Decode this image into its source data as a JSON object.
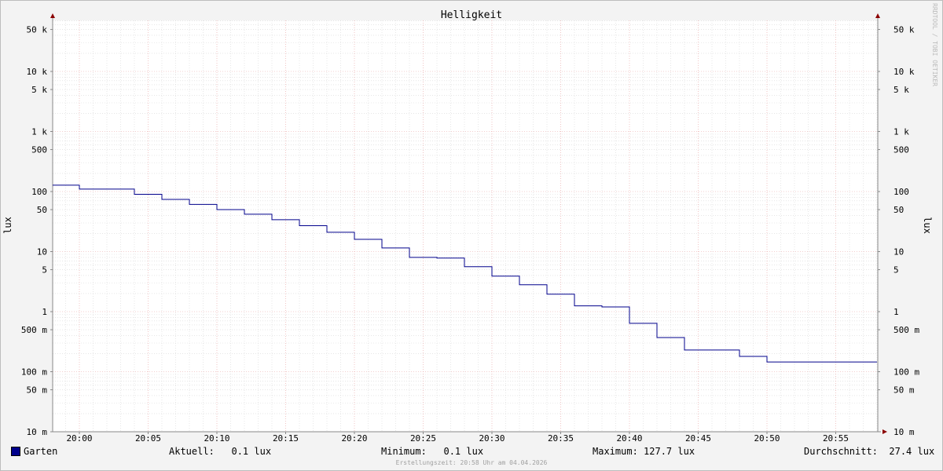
{
  "chart_data": {
    "type": "line",
    "title": "Helligkeit",
    "ylabel": "lux",
    "ylabel_right": "lux",
    "y_scale": "log",
    "ylim": [
      10,
      70000
    ],
    "xlim": [
      "19:58",
      "20:58"
    ],
    "y_ticks": [
      {
        "value": 10,
        "label": "10 m"
      },
      {
        "value": 50,
        "label": "50 m"
      },
      {
        "value": 100,
        "label": "100 m"
      },
      {
        "value": 500,
        "label": "500 m"
      },
      {
        "value": 1000,
        "label": "1"
      },
      {
        "value": 5000,
        "label": "5"
      },
      {
        "value": 10000,
        "label": "10"
      },
      {
        "value": 50000,
        "label": "50"
      },
      {
        "value": 100000,
        "label": "100"
      },
      {
        "value": 500000,
        "label": "500"
      },
      {
        "value": 1000000,
        "label": "1 k"
      },
      {
        "value": 5000000,
        "label": "5 k"
      },
      {
        "value": 10000000,
        "label": "10 k"
      },
      {
        "value": 50000000,
        "label": "50 k"
      }
    ],
    "x_ticks": [
      "20:00",
      "20:05",
      "20:10",
      "20:15",
      "20:20",
      "20:25",
      "20:30",
      "20:35",
      "20:40",
      "20:45",
      "20:50",
      "20:55"
    ],
    "series": [
      {
        "name": "Garten",
        "color": "#00008b",
        "y_unit": "mlux",
        "points": [
          {
            "x": "19:58",
            "y": 127700
          },
          {
            "x": "20:00",
            "y": 110000
          },
          {
            "x": "20:04",
            "y": 90000
          },
          {
            "x": "20:06",
            "y": 74000
          },
          {
            "x": "20:08",
            "y": 61000
          },
          {
            "x": "20:10",
            "y": 50000
          },
          {
            "x": "20:12",
            "y": 42000
          },
          {
            "x": "20:14",
            "y": 34000
          },
          {
            "x": "20:16",
            "y": 27000
          },
          {
            "x": "20:18",
            "y": 21000
          },
          {
            "x": "20:20",
            "y": 16000
          },
          {
            "x": "20:22",
            "y": 11500
          },
          {
            "x": "20:24",
            "y": 8000
          },
          {
            "x": "20:26",
            "y": 7800
          },
          {
            "x": "20:28",
            "y": 5600
          },
          {
            "x": "20:30",
            "y": 3900
          },
          {
            "x": "20:32",
            "y": 2800
          },
          {
            "x": "20:34",
            "y": 1950
          },
          {
            "x": "20:36",
            "y": 1250
          },
          {
            "x": "20:38",
            "y": 1200
          },
          {
            "x": "20:40",
            "y": 640
          },
          {
            "x": "20:42",
            "y": 370
          },
          {
            "x": "20:44",
            "y": 230
          },
          {
            "x": "20:48",
            "y": 180
          },
          {
            "x": "20:50",
            "y": 145
          },
          {
            "x": "20:58",
            "y": 145
          }
        ]
      }
    ],
    "legend_position": "bottom-left",
    "grid": true
  },
  "legend": {
    "series_name": "Garten",
    "current": "Aktuell:   0.1 lux",
    "minimum": "Minimum:   0.1 lux",
    "maximum": "Maximum: 127.7 lux",
    "average": "Durchschnitt:  27.4 lux"
  },
  "footer": "Erstellungszeit: 20:58 Uhr am 04.04.2026",
  "watermark": "RRDTOOL / TOBI OETIKER"
}
